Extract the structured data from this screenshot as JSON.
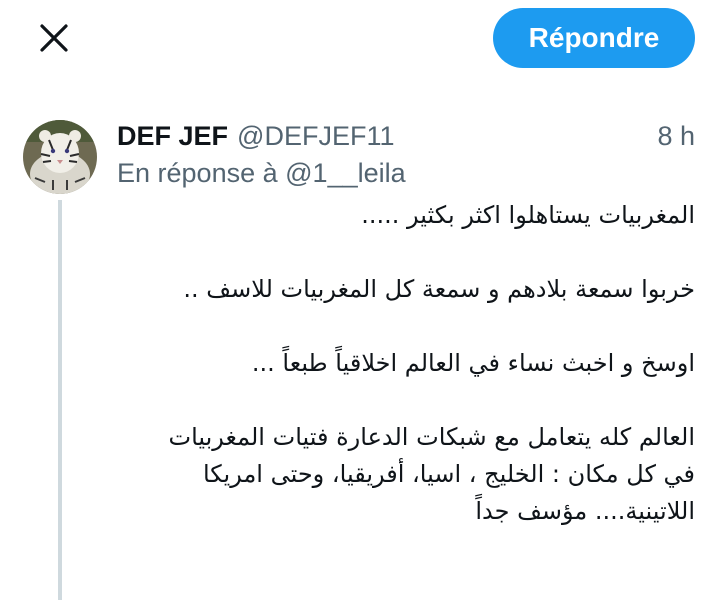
{
  "header": {
    "close_icon": "close-icon",
    "reply_label": "Répondre",
    "accent_color": "#1d9bf0"
  },
  "tweet": {
    "author_name": "DEF JEF",
    "author_handle": "@DEFJEF11",
    "time": "8 h",
    "reply_prefix": "En réponse à",
    "reply_to": "@1__leila",
    "avatar_icon": "white-tiger-avatar",
    "lines": [
      "المغربيات يستاهلوا اكثر بكثير .....",
      "",
      "خربوا سمعة بلادهم و سمعة كل المغربيات للاسف ..",
      "",
      "اوسخ و اخبث نساء في العالم اخلاقياً طبعاً ...",
      "",
      "العالم كله يتعامل مع شبكات الدعارة فتيات المغربيات",
      "في كل مكان : الخليج ، اسيا، أفريقيا، وحتى امريكا",
      "اللاتينية.... مؤسف جداً"
    ]
  }
}
